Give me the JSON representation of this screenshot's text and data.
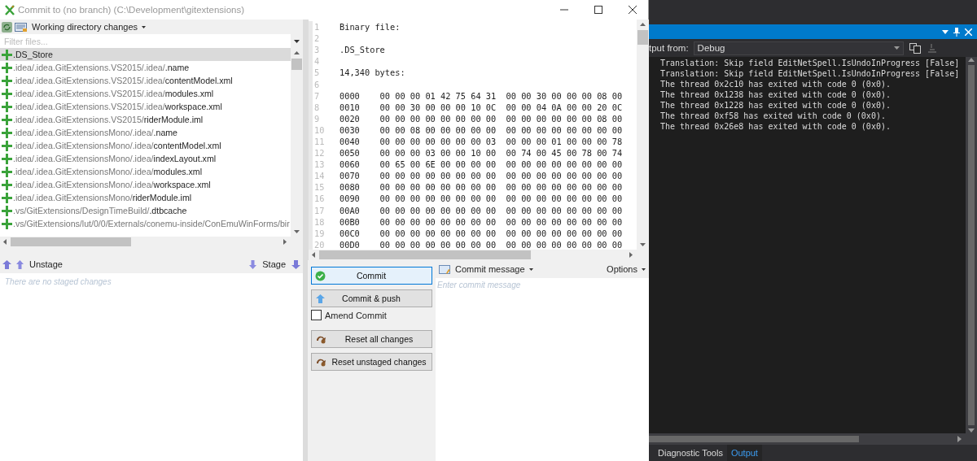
{
  "window": {
    "title": "Commit to (no branch) (C:\\Development\\gitextensions)"
  },
  "unstaged": {
    "view_label": "Working directory changes",
    "filter": {
      "placeholder": "Filter files..."
    },
    "files": [
      {
        "name": ".DS_Store",
        "selected": true
      },
      {
        "dir": ".idea/.idea.GitExtensions.VS2015/.idea/",
        "name": ".name",
        "selected": false
      },
      {
        "dir": ".idea/.idea.GitExtensions.VS2015/.idea/",
        "name": "contentModel.xml",
        "selected": false
      },
      {
        "dir": ".idea/.idea.GitExtensions.VS2015/.idea/",
        "name": "modules.xml",
        "selected": false
      },
      {
        "dir": ".idea/.idea.GitExtensions.VS2015/.idea/",
        "name": "workspace.xml",
        "selected": false
      },
      {
        "dir": ".idea/.idea.GitExtensions.VS2015/",
        "name": "riderModule.iml",
        "selected": false
      },
      {
        "dir": ".idea/.idea.GitExtensionsMono/.idea/",
        "name": ".name",
        "selected": false
      },
      {
        "dir": ".idea/.idea.GitExtensionsMono/.idea/",
        "name": "contentModel.xml",
        "selected": false
      },
      {
        "dir": ".idea/.idea.GitExtensionsMono/.idea/",
        "name": "indexLayout.xml",
        "selected": false
      },
      {
        "dir": ".idea/.idea.GitExtensionsMono/.idea/",
        "name": "modules.xml",
        "selected": false
      },
      {
        "dir": ".idea/.idea.GitExtensionsMono/.idea/",
        "name": "workspace.xml",
        "selected": false
      },
      {
        "dir": ".idea/.idea.GitExtensionsMono/",
        "name": "riderModule.iml",
        "selected": false
      },
      {
        "dir": ".vs/GitExtensions/DesignTimeBuild/",
        "name": ".dtbcache",
        "selected": false
      },
      {
        "dir": ".vs/GitExtensions/lut/0/0/Externals/conemu-inside/ConEmuWinForms/bir",
        "selected": false
      }
    ]
  },
  "staged": {
    "unstage_label": "Unstage",
    "stage_label": "Stage",
    "empty_text": "There are no staged changes"
  },
  "diff": {
    "lines": [
      {
        "number": "1",
        "text": "Binary file:"
      },
      {
        "number": "2"
      },
      {
        "number": "3",
        "text": ".DS_Store"
      },
      {
        "number": "4"
      },
      {
        "number": "5",
        "text": "14,340 bytes:"
      },
      {
        "number": "6"
      },
      {
        "number": "7",
        "text": "0000    00 00 00 01 42 75 64 31  00 00 30 00 00 00 08 00"
      },
      {
        "number": "8",
        "text": "0010    00 00 30 00 00 00 10 0C  00 00 04 0A 00 00 20 0C"
      },
      {
        "number": "9",
        "text": "0020    00 00 00 00 00 00 00 00  00 00 00 00 00 00 08 00"
      },
      {
        "number": "10",
        "text": "0030    00 00 08 00 00 00 00 00  00 00 00 00 00 00 00 00"
      },
      {
        "number": "11",
        "text": "0040    00 00 00 00 00 00 00 03  00 00 00 01 00 00 00 78"
      },
      {
        "number": "12",
        "text": "0050    00 00 00 03 00 00 10 00  00 74 00 45 00 78 00 74"
      },
      {
        "number": "13",
        "text": "0060    00 65 00 6E 00 00 00 00  00 00 00 00 00 00 00 00"
      },
      {
        "number": "14",
        "text": "0070    00 00 00 00 00 00 00 00  00 00 00 00 00 00 00 00"
      },
      {
        "number": "15",
        "text": "0080    00 00 00 00 00 00 00 00  00 00 00 00 00 00 00 00"
      },
      {
        "number": "16",
        "text": "0090    00 00 00 00 00 00 00 00  00 00 00 00 00 00 00 00"
      },
      {
        "number": "17",
        "text": "00A0    00 00 00 00 00 00 00 00  00 00 00 00 00 00 00 00"
      },
      {
        "number": "18",
        "text": "00B0    00 00 00 00 00 00 00 00  00 00 00 00 00 00 00 00"
      },
      {
        "number": "19",
        "text": "00C0    00 00 00 00 00 00 00 00  00 00 00 00 00 00 00 00"
      },
      {
        "number": "20",
        "text": "00D0    00 00 00 00 00 00 00 00  00 00 00 00 00 00 00 00"
      }
    ]
  },
  "actions": {
    "buttons": [
      {
        "label": "Commit",
        "kind": "commit",
        "focused": true
      },
      {
        "label": "Commit & push",
        "kind": "push",
        "focused": false
      }
    ],
    "amend": {
      "label": "Amend Commit",
      "checked": false
    },
    "reset_buttons": [
      {
        "label": "Reset all changes"
      },
      {
        "label": "Reset unstaged changes"
      }
    ]
  },
  "commit_message": {
    "label": "Commit message",
    "options_label": "Options",
    "placeholder": "Enter commit message"
  },
  "output_pane": {
    "source_label": "tput from:",
    "source": "Debug",
    "lines": [
      "Translation: Skip field EditNetSpell.IsUndoInProgress [False]",
      "Translation: Skip field EditNetSpell.IsUndoInProgress [False]",
      "The thread 0x2c10 has exited with code 0 (0x0).",
      "The thread 0x1238 has exited with code 0 (0x0).",
      "The thread 0x1228 has exited with code 0 (0x0).",
      "The thread 0xf58 has exited with code 0 (0x0).",
      "The thread 0x26e8 has exited with code 0 (0x0)."
    ],
    "tabs": [
      {
        "label": "Diagnostic Tools",
        "selected": false
      },
      {
        "label": "Output",
        "selected": true
      }
    ]
  }
}
